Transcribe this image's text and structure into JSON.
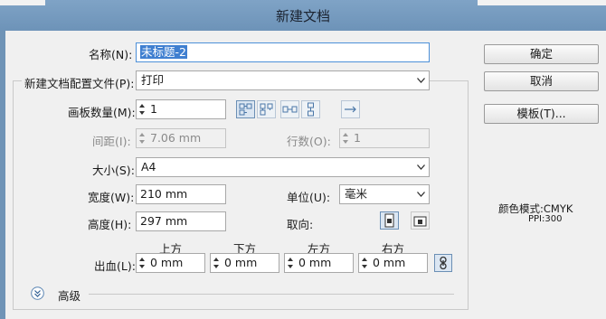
{
  "window": {
    "title": "新建文档"
  },
  "form": {
    "name": {
      "label": "名称(N):",
      "value": "未标题-2"
    },
    "profile": {
      "label": "新建文档配置文件(P):",
      "value": "打印"
    },
    "artboards": {
      "label": "画板数量(M):",
      "value": "1",
      "layout_icons": [
        "grid-by-row-icon",
        "grid-by-column-icon",
        "arrange-by-row-icon",
        "arrange-by-column-icon",
        "right-to-left-icon"
      ]
    },
    "spacing": {
      "label": "间距(I):",
      "value": "7.06 mm"
    },
    "columns": {
      "label": "行数(O):",
      "value": "1"
    },
    "size": {
      "label": "大小(S):",
      "value": "A4"
    },
    "width": {
      "label": "宽度(W):",
      "value": "210 mm"
    },
    "units": {
      "label": "单位(U):",
      "value": "毫米"
    },
    "height": {
      "label": "高度(H):",
      "value": "297 mm"
    },
    "orientation": {
      "label": "取向:",
      "options": [
        "portrait-icon",
        "landscape-icon"
      ],
      "selected": "portrait-icon"
    },
    "bleed": {
      "label": "出血(L):",
      "headers": [
        "上方",
        "下方",
        "左方",
        "右方"
      ],
      "values": [
        "0 mm",
        "0 mm",
        "0 mm",
        "0 mm"
      ],
      "link_icon": "link-icon"
    },
    "advanced": {
      "label": "高级"
    }
  },
  "buttons": {
    "ok": "确定",
    "cancel": "取消",
    "templates": "模板(T)..."
  },
  "info": {
    "color_mode": "颜色模式:CMYK",
    "ppi": "PPI:300"
  },
  "colors": {
    "titlebar": "#6f93b6",
    "dialog_bg": "#f0f0f0",
    "selection": "#3f7fd0",
    "icon_blue": "#4a77a8"
  }
}
